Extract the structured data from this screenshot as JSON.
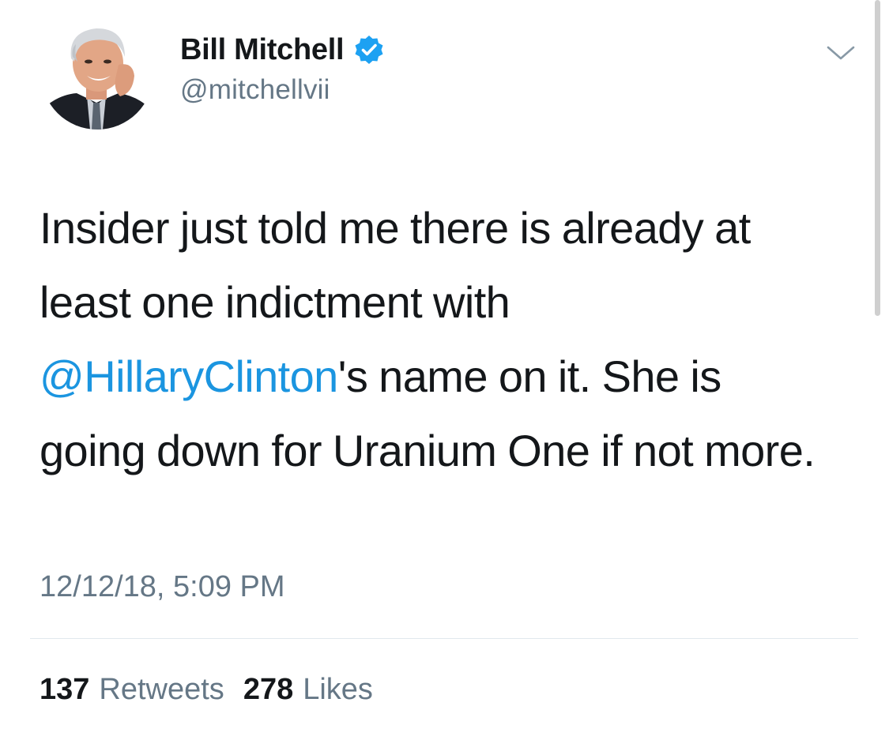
{
  "author": {
    "display_name": "Bill Mitchell",
    "handle": "@mitchellvii",
    "verified": true,
    "avatar_icon": "profile-photo"
  },
  "tweet": {
    "text_before_mention": "Insider just told me there is already at least one indictment with ",
    "mention": "@HillaryClinton",
    "text_after_mention": "'s name on it.  She is going down for Uranium One if not more.",
    "timestamp": "12/12/18, 5:09 PM"
  },
  "stats": {
    "retweets_count": "137",
    "retweets_label": "Retweets",
    "likes_count": "278",
    "likes_label": "Likes"
  },
  "colors": {
    "link": "#1b95e0",
    "verified": "#1da1f2",
    "secondary_text": "#657786",
    "primary_text": "#14171a",
    "divider": "#e1e8ed"
  },
  "icons": {
    "verified": "verified-badge-icon",
    "menu": "chevron-down-icon"
  }
}
